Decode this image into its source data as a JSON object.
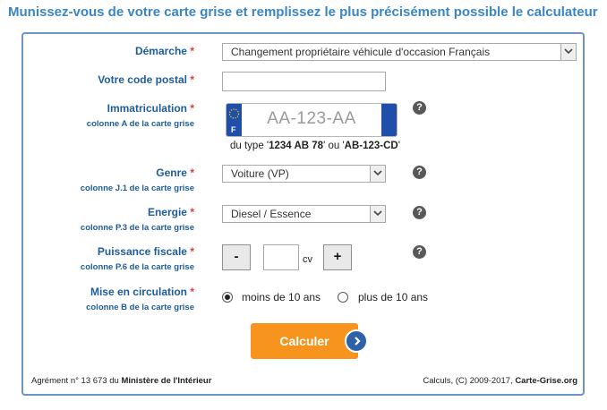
{
  "title": "Munissez-vous de votre carte grise et remplissez le plus précisément possible le calculateur",
  "required_mark": "*",
  "fields": {
    "demarche": {
      "label": "Démarche",
      "value": "Changement propriétaire véhicule d'occasion Français"
    },
    "code_postal": {
      "label": "Votre code postal",
      "value": ""
    },
    "immatriculation": {
      "label": "Immatriculation",
      "sublabel": "colonne A de la carte grise",
      "plate_country": "F",
      "plate_placeholder": "AA-123-AA",
      "hint_prefix": "du type '",
      "hint_ex1": "1234 AB 78",
      "hint_mid": "' ou '",
      "hint_ex2": "AB-123-CD",
      "hint_suffix": "'"
    },
    "genre": {
      "label": "Genre",
      "sublabel": "colonne J.1 de la carte grise",
      "value": "Voiture (VP)"
    },
    "energie": {
      "label": "Energie",
      "sublabel": "colonne P.3 de la carte grise",
      "value": "Diesel / Essence"
    },
    "puissance": {
      "label": "Puissance fiscale",
      "sublabel": "colonne P.6 de la carte grise",
      "minus": "-",
      "plus": "+",
      "value": "",
      "unit": "cv"
    },
    "mise_circulation": {
      "label": "Mise en circulation",
      "sublabel": "colonne B de la carte grise",
      "options": [
        "moins de 10 ans",
        "plus de 10 ans"
      ],
      "selected": 0
    }
  },
  "help_icon": "?",
  "submit_label": "Calculer",
  "footer": {
    "left_prefix": "Agrément n° 13 673 du ",
    "left_bold": "Ministère de l'Intérieur",
    "right_prefix": "Calculs, (C) 2009-2017, ",
    "right_bold": "Carte-Grise.org"
  },
  "colors": {
    "title": "#3a86c4",
    "label": "#1e5c9a",
    "required": "#e23a3a",
    "button": "#f7941d",
    "plate_blue": "#1f4fa8"
  }
}
